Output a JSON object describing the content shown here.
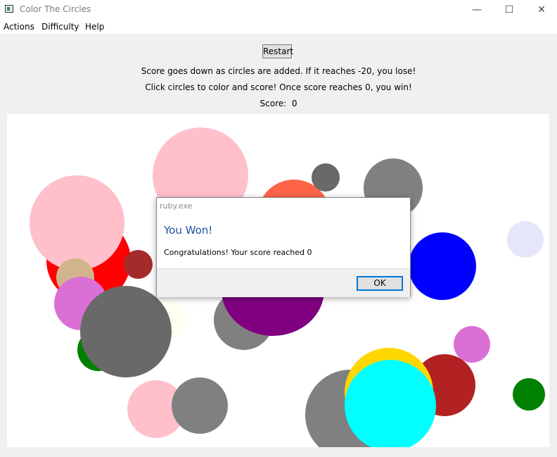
{
  "window": {
    "title": "Color The Circles",
    "minimize_glyph": "—",
    "maximize_glyph": "☐",
    "close_glyph": "✕"
  },
  "menu": [
    "Actions",
    "Difficulty",
    "Help"
  ],
  "toolbar": {
    "restart_label": "Restart"
  },
  "info": {
    "line1": "Score goes down as circles are added. If it reaches -20, you lose!",
    "line2": "Click circles to color and score! Once score reaches 0, you win!",
    "score_label": "Score:",
    "score_value": "0"
  },
  "dialog": {
    "title": "ruby.exe",
    "heading": "You Won!",
    "message": "Congratulations! Your score reached 0",
    "ok_label": "OK"
  },
  "circle_colors": {
    "pink": "#ffc0cb",
    "tomato": "#ff6347",
    "dim_gray": "#696969",
    "gray": "#808080",
    "red": "#ff0000",
    "brown": "#a52a2a",
    "tan": "#d2b48c",
    "orchid": "#da70d6",
    "green": "#008000",
    "ivory": "#fffff0",
    "purple": "#800080",
    "blue": "#0000ff",
    "lavender": "#e6e6fa",
    "gold": "#ffd700",
    "firebrick": "#b22222",
    "cyan": "#00ffff"
  }
}
